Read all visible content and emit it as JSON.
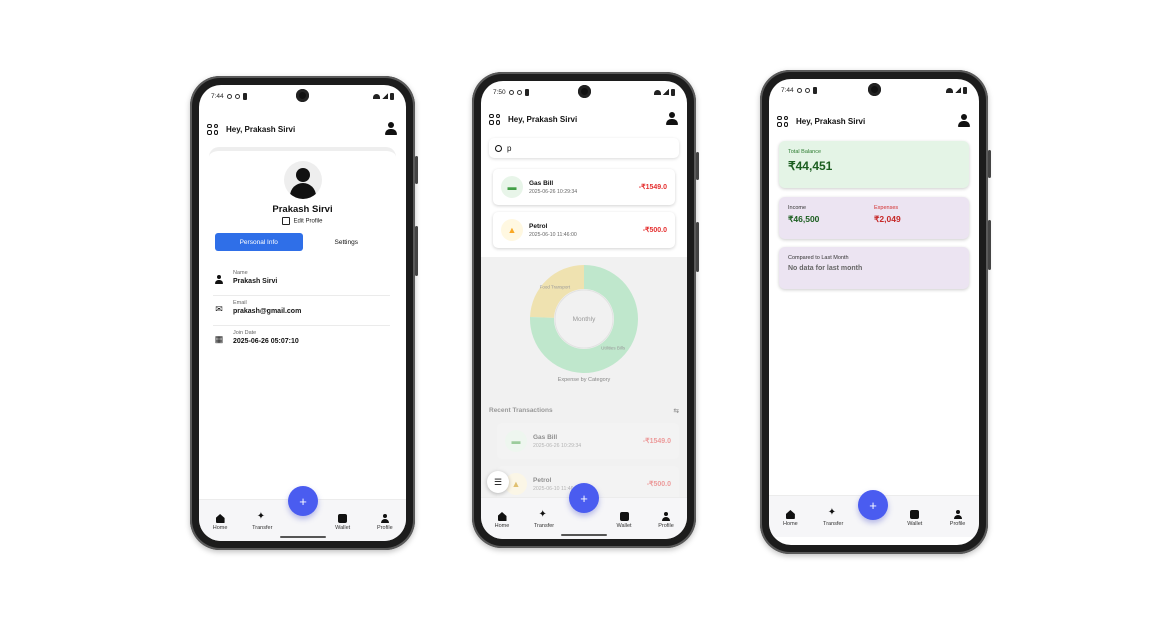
{
  "status": {
    "phone1_time": "7:44",
    "phone2_time": "7:50",
    "phone3_time": "7:44"
  },
  "header": {
    "greeting": "Hey, Prakash Sirvi"
  },
  "nav": {
    "home": "Home",
    "transfer": "Transfer",
    "wallet": "Wallet",
    "profile": "Profile",
    "fab_symbol": "+"
  },
  "profile_screen": {
    "name": "Prakash Sirvi",
    "edit_label": "Edit Profile",
    "tabs": [
      {
        "label": "Personal Info",
        "active": true
      },
      {
        "label": "Settings",
        "active": false
      }
    ],
    "fields": [
      {
        "label": "Name",
        "value": "Prakash Sirvi",
        "icon": "person-icon"
      },
      {
        "label": "Email",
        "value": "prakash@gmail.com",
        "icon": "mail-icon"
      },
      {
        "label": "Join Date",
        "value": "2025-06-26 05:07:10",
        "icon": "calendar-icon"
      }
    ]
  },
  "search_screen": {
    "query": "p",
    "results": [
      {
        "name": "Gas Bill",
        "date": "2025-06-26 10:29:34",
        "amount": "-₹1549.0",
        "icon": "bill-icon"
      },
      {
        "name": "Petrol",
        "date": "2025-06-10 11:46:00",
        "amount": "-₹500.0",
        "icon": "taxi-icon"
      }
    ],
    "chart_caption": "Expense by Category",
    "recent_header": "Recent Transactions",
    "recent": [
      {
        "name": "Gas Bill",
        "date": "2025-06-26 10:29:34",
        "amount": "-₹1549.0"
      },
      {
        "name": "Petrol",
        "date": "2025-06-10 11:46:00",
        "amount": "-₹500.0"
      }
    ]
  },
  "chart_data": {
    "type": "pie",
    "center_label": "Monthly",
    "categories": [
      "Food Transport",
      "Utilities Bills"
    ],
    "values": [
      24.4,
      75.6
    ],
    "colors": [
      "#efe2b0",
      "#bfe7cc"
    ]
  },
  "home_screen": {
    "balance_label": "Total Balance",
    "balance": "₹44,451",
    "income_label": "Income",
    "income": "₹46,500",
    "expenses_label": "Expenses",
    "expenses": "₹2,049",
    "compare_label": "Compared to Last Month",
    "compare_value": "No data for last month"
  },
  "colors": {
    "primary": "#4a5cf0",
    "tab_active": "#2f6fe8",
    "expense_red": "#e53030",
    "income_green": "#1b5e20"
  }
}
